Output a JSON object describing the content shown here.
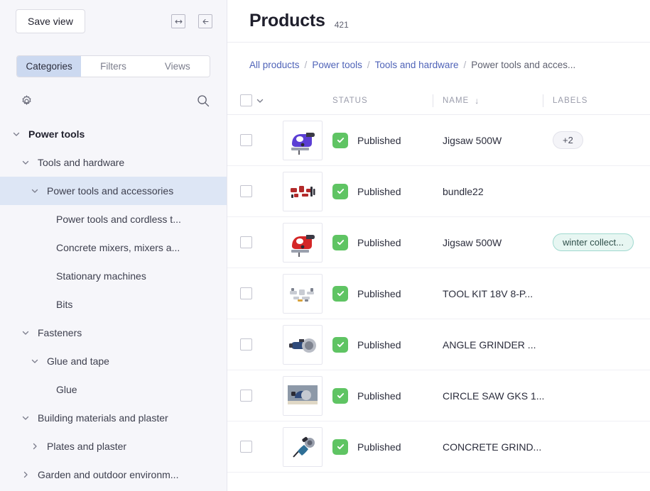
{
  "sidebar": {
    "save_view_label": "Save view",
    "icons": {
      "resize": "resize-horizontal-icon",
      "collapse": "collapse-left-icon",
      "settings": "gear-icon",
      "search": "search-icon"
    },
    "tabs": [
      {
        "label": "Categories",
        "active": true
      },
      {
        "label": "Filters",
        "active": false
      },
      {
        "label": "Views",
        "active": false
      }
    ],
    "tree": [
      {
        "label": "Power tools",
        "depth": 0,
        "chevron": "down",
        "selected": false,
        "bold": true
      },
      {
        "label": "Tools and hardware",
        "depth": 1,
        "chevron": "down",
        "selected": false,
        "bold": false
      },
      {
        "label": "Power tools and accessories",
        "depth": 2,
        "chevron": "down",
        "selected": true,
        "bold": false
      },
      {
        "label": "Power tools and cordless t...",
        "depth": 3,
        "chevron": "none",
        "selected": false,
        "bold": false
      },
      {
        "label": "Concrete mixers, mixers a...",
        "depth": 3,
        "chevron": "none",
        "selected": false,
        "bold": false
      },
      {
        "label": "Stationary machines",
        "depth": 3,
        "chevron": "none",
        "selected": false,
        "bold": false
      },
      {
        "label": "Bits",
        "depth": 3,
        "chevron": "none",
        "selected": false,
        "bold": false
      },
      {
        "label": "Fasteners",
        "depth": 1,
        "chevron": "down",
        "selected": false,
        "bold": false
      },
      {
        "label": "Glue and tape",
        "depth": 2,
        "chevron": "down",
        "selected": false,
        "bold": false
      },
      {
        "label": "Glue",
        "depth": 3,
        "chevron": "none",
        "selected": false,
        "bold": false
      },
      {
        "label": "Building materials and plaster",
        "depth": 1,
        "chevron": "down",
        "selected": false,
        "bold": false
      },
      {
        "label": "Plates and plaster",
        "depth": 2,
        "chevron": "right",
        "selected": false,
        "bold": false
      },
      {
        "label": "Garden and outdoor environm...",
        "depth": 1,
        "chevron": "right",
        "selected": false,
        "bold": false
      }
    ]
  },
  "header": {
    "title": "Products",
    "count": "421"
  },
  "breadcrumb": [
    {
      "label": "All products",
      "last": false
    },
    {
      "label": "Power tools",
      "last": false
    },
    {
      "label": "Tools and hardware",
      "last": false
    },
    {
      "label": "Power tools and acces...",
      "last": true
    }
  ],
  "breadcrumb_separator": "/",
  "table": {
    "columns": [
      {
        "label": "STATUS",
        "sorted": false
      },
      {
        "label": "NAME",
        "sorted": true,
        "sort_direction": "down"
      },
      {
        "label": "LABELS",
        "sorted": false
      }
    ],
    "sort_arrow_glyph": "↓",
    "rows": [
      {
        "status": "Published",
        "name": "Jigsaw 500W",
        "thumb": "jigsaw-purple-thumbnail",
        "labels": [
          {
            "text": "+2",
            "type": "count"
          }
        ]
      },
      {
        "status": "Published",
        "name": "bundle22",
        "thumb": "tool-bundle-thumbnail",
        "labels": []
      },
      {
        "status": "Published",
        "name": "Jigsaw 500W",
        "thumb": "jigsaw-red-thumbnail",
        "labels": [
          {
            "text": "winter collect...",
            "type": "collection"
          }
        ]
      },
      {
        "status": "Published",
        "name": "TOOL KIT 18V 8-P...",
        "thumb": "tool-kit-thumbnail",
        "labels": []
      },
      {
        "status": "Published",
        "name": "ANGLE GRINDER ...",
        "thumb": "angle-grinder-thumbnail",
        "labels": []
      },
      {
        "status": "Published",
        "name": "CIRCLE SAW GKS 1...",
        "thumb": "circle-saw-thumbnail",
        "labels": []
      },
      {
        "status": "Published",
        "name": "CONCRETE GRIND...",
        "thumb": "concrete-grinder-thumbnail",
        "labels": []
      }
    ]
  },
  "colors": {
    "accent_link": "#4f63b8",
    "tab_active_bg": "#ccd9f0",
    "tree_selected_bg": "#dde6f5",
    "status_green": "#5fc463",
    "chip_collection_bg": "#e7f6f2",
    "chip_collection_border": "#9fd9cf",
    "sidebar_bg": "#f6f6fa"
  }
}
